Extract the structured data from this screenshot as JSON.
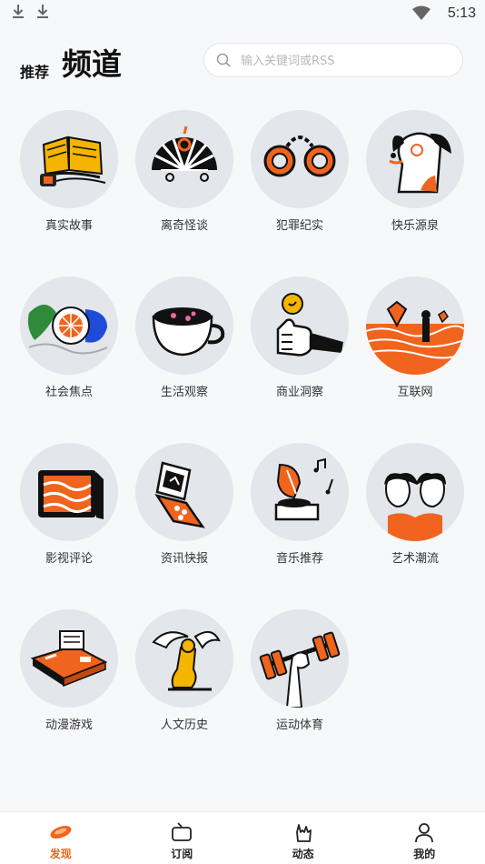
{
  "status_bar": {
    "time": "5:13"
  },
  "header": {
    "tab_recommend": "推荐",
    "tab_channels": "频道"
  },
  "search": {
    "placeholder": "输入关键词或RSS",
    "value": ""
  },
  "channels": [
    {
      "label": "真实故事",
      "icon": "open-book-icon"
    },
    {
      "label": "离奇怪谈",
      "icon": "folding-fan-icon"
    },
    {
      "label": "犯罪纪实",
      "icon": "handcuffs-icon"
    },
    {
      "label": "快乐源泉",
      "icon": "happy-dog-icon"
    },
    {
      "label": "社会焦点",
      "icon": "target-waves-icon"
    },
    {
      "label": "生活观察",
      "icon": "coffee-cup-icon"
    },
    {
      "label": "商业洞察",
      "icon": "thumbs-up-coin-icon"
    },
    {
      "label": "互联网",
      "icon": "sea-figure-icon"
    },
    {
      "label": "影视评论",
      "icon": "film-screen-icon"
    },
    {
      "label": "资讯快报",
      "icon": "flip-phone-icon"
    },
    {
      "label": "音乐推荐",
      "icon": "gramophone-icon"
    },
    {
      "label": "艺术潮流",
      "icon": "two-faces-icon"
    },
    {
      "label": "动漫游戏",
      "icon": "game-console-icon"
    },
    {
      "label": "人文历史",
      "icon": "sphinx-icon"
    },
    {
      "label": "运动体育",
      "icon": "dumbbell-icon"
    }
  ],
  "bottom_nav": [
    {
      "label": "发现",
      "icon": "discover-icon",
      "active": true
    },
    {
      "label": "订阅",
      "icon": "tv-icon",
      "active": false
    },
    {
      "label": "动态",
      "icon": "hand-rock-icon",
      "active": false
    },
    {
      "label": "我的",
      "icon": "person-icon",
      "active": false
    }
  ],
  "colors": {
    "accent": "#f0641e",
    "circle_bg": "#e3e6ea",
    "yellow": "#f5b400"
  }
}
